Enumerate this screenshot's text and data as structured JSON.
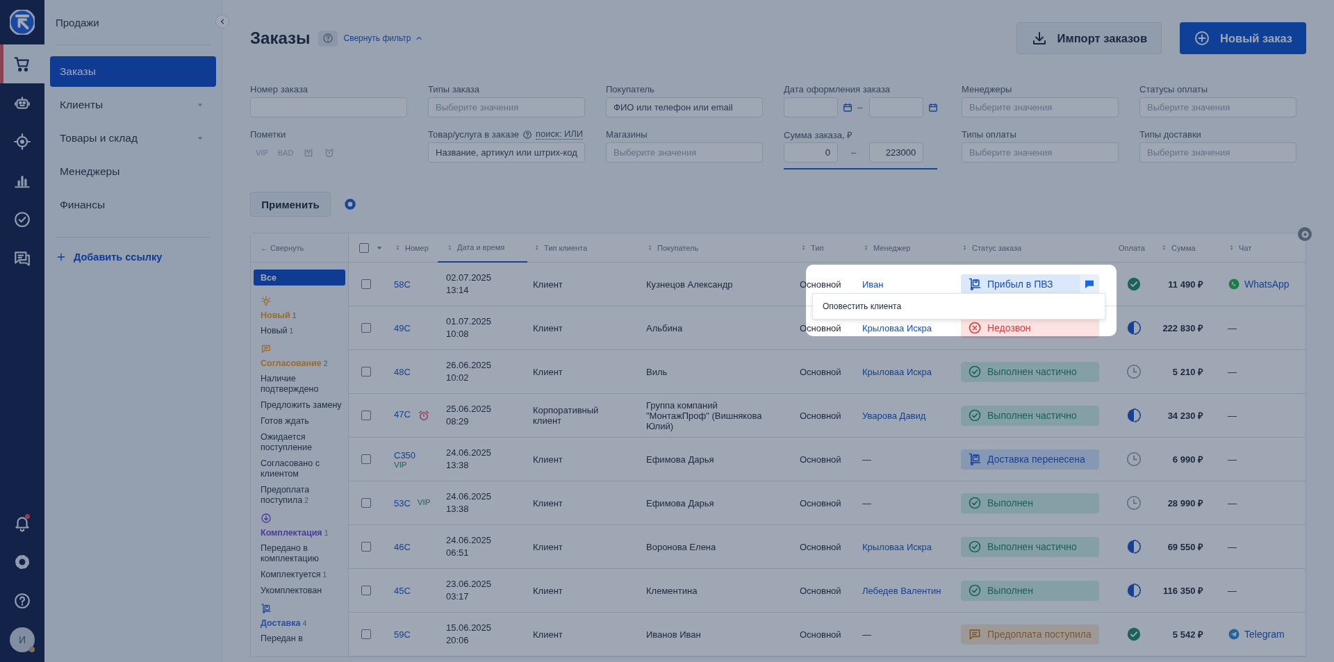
{
  "rail": {
    "items": [
      {
        "kind": "cart",
        "selected": true
      },
      {
        "kind": "robot",
        "selected": false
      },
      {
        "kind": "target",
        "selected": false
      },
      {
        "kind": "bars",
        "selected": false
      },
      {
        "kind": "checkc",
        "selected": false
      },
      {
        "kind": "chat",
        "selected": false
      }
    ],
    "bottom": [
      {
        "kind": "bell",
        "badge": true
      },
      {
        "kind": "gear",
        "badge": false
      },
      {
        "kind": "help",
        "badge": false
      }
    ],
    "avatar": "И"
  },
  "sidebar": {
    "title": "Продажи",
    "items": [
      {
        "label": "Заказы",
        "selected": true,
        "submenu": false
      },
      {
        "label": "Клиенты",
        "selected": false,
        "submenu": true
      },
      {
        "label": "Товары и склад",
        "selected": false,
        "submenu": true
      },
      {
        "label": "Менеджеры",
        "selected": false,
        "submenu": false
      },
      {
        "label": "Финансы",
        "selected": false,
        "submenu": false
      }
    ],
    "add_link": "Добавить ссылку"
  },
  "header": {
    "title": "Заказы",
    "toggle": "Свернуть фильтр",
    "import": "Импорт заказов",
    "new": "Новый заказ"
  },
  "filters": [
    {
      "kind": "text",
      "label": "Номер заказа"
    },
    {
      "kind": "select",
      "label": "Типы заказа",
      "placeholder": "Выберите значения"
    },
    {
      "kind": "text",
      "label": "Покупатель",
      "placeholder": "ФИО или телефон или email"
    },
    {
      "kind": "date_range",
      "label": "Дата оформления заказа",
      "dash": "–"
    },
    {
      "kind": "select",
      "label": "Менеджеры",
      "placeholder": "Выберите значения"
    },
    {
      "kind": "select",
      "label": "Статусы оплаты",
      "placeholder": "Выберите значения"
    },
    {
      "kind": "marks",
      "label": "Пометки",
      "marks": [
        {
          "kind": "text",
          "label": "VIP"
        },
        {
          "kind": "text",
          "label": "BAD"
        },
        {
          "kind": "box"
        },
        {
          "kind": "alarm"
        }
      ]
    },
    {
      "kind": "product",
      "label": "Товар/услуга в заказе",
      "link": "поиск: ИЛИ",
      "placeholder": "Название, артикул или штрих-код"
    },
    {
      "kind": "select",
      "label": "Магазины",
      "placeholder": "Выберите значения"
    },
    {
      "kind": "range",
      "label": "Сумма заказа, ₽",
      "from": "0",
      "dash": "–",
      "to": "223000"
    },
    {
      "kind": "select",
      "label": "Типы оплаты",
      "placeholder": "Выберите значения"
    },
    {
      "kind": "select",
      "label": "Типы доставки",
      "placeholder": "Выберите значения"
    }
  ],
  "apply": "Применить",
  "status_panel": {
    "collapse": "← Свернуть",
    "all": {
      "label": "Все",
      "selected": true
    },
    "groups": [
      {
        "kind": "new",
        "label": "Новый",
        "count": "1",
        "color": "#9c6a2c",
        "items": [
          {
            "label": "Новый",
            "count": "1"
          }
        ]
      },
      {
        "kind": "agree",
        "label": "Согласование",
        "count": "2",
        "color": "#9c6a2c",
        "items": [
          {
            "label": "Наличие подтверждено"
          },
          {
            "label": "Предложить замену"
          },
          {
            "label": "Готов ждать"
          },
          {
            "label": "Ожидается поступление"
          },
          {
            "label": "Согласовано с клиентом"
          },
          {
            "label": "Предоплата поступила",
            "count": "2"
          }
        ]
      },
      {
        "kind": "pack",
        "label": "Комплектация",
        "count": "1",
        "color": "#4a3c98",
        "items": [
          {
            "label": "Передано в комплектацию"
          },
          {
            "label": "Комплектуется",
            "count": "1"
          },
          {
            "label": "Укомплектован"
          }
        ]
      },
      {
        "kind": "delivery",
        "label": "Доставка",
        "count": "4",
        "color": "#2a4ea0",
        "items": [
          {
            "label": "Передан в"
          }
        ]
      }
    ]
  },
  "table": {
    "all_checked": false,
    "columns": [
      {
        "label": "Номер",
        "sortable": true,
        "sorted": false
      },
      {
        "label": "Дата и время",
        "sortable": true,
        "sorted": true
      },
      {
        "label": "Тип клиента",
        "sortable": true,
        "sorted": false
      },
      {
        "label": "Покупатель",
        "sortable": true,
        "sorted": false
      },
      {
        "label": "Тип",
        "sortable": true,
        "sorted": false
      },
      {
        "label": "Менеджер",
        "sortable": true,
        "sorted": false
      },
      {
        "label": "Статус заказа",
        "sortable": true,
        "sorted": false
      },
      {
        "label": "Оплата",
        "sortable": false,
        "sorted": false
      },
      {
        "label": "Сумма",
        "sortable": true,
        "sorted": false
      },
      {
        "label": "Чат",
        "sortable": true,
        "sorted": false
      }
    ],
    "rows": [
      {
        "checked": false,
        "number": "58С",
        "alarm": false,
        "date": "02.07.2025 13:14",
        "client_type": "Клиент",
        "buyer": "Кузнецов Александр",
        "type": "Основной",
        "manager": {
          "name": "Иван",
          "link": true
        },
        "status": {
          "kind": "pvz",
          "label": "Прибыл в ПВЗ"
        },
        "notify": true,
        "payment": {
          "kind": "paid"
        },
        "sum": "11 490 ₽",
        "chat": {
          "kind": "whatsapp",
          "label": "WhatsApp"
        }
      },
      {
        "checked": false,
        "number": "49С",
        "alarm": false,
        "date": "01.07.2025 10:08",
        "client_type": "Клиент",
        "buyer": "Альбина",
        "type": "Основной",
        "manager": {
          "name": "Крыловаа Искра",
          "link": true
        },
        "status": {
          "kind": "missed",
          "label": "Недозвон"
        },
        "notify": false,
        "payment": {
          "kind": "partial"
        },
        "sum": "222 830 ₽",
        "chat": {
          "kind": "none",
          "label": "—"
        }
      },
      {
        "checked": false,
        "number": "48С",
        "alarm": false,
        "date": "26.06.2025 10:02",
        "client_type": "Клиент",
        "buyer": "Виль",
        "type": "Основной",
        "manager": {
          "name": "Крыловаа Искра",
          "link": true
        },
        "status": {
          "kind": "done",
          "label": "Выполнен частично"
        },
        "notify": false,
        "payment": {
          "kind": "pending"
        },
        "sum": "5 210 ₽",
        "chat": {
          "kind": "none",
          "label": "—"
        }
      },
      {
        "checked": false,
        "number": "47С",
        "alarm": true,
        "date": "25.06.2025 08:29",
        "client_type": "Корпоративный клиент",
        "buyer": "Группа компаний \"МонтажПроф\" (Вишнякова Юлий)",
        "type": "Основной",
        "manager": {
          "name": "Уварова Давид",
          "link": true
        },
        "status": {
          "kind": "done",
          "label": "Выполнен частично"
        },
        "notify": false,
        "payment": {
          "kind": "partial"
        },
        "sum": "34 230 ₽",
        "chat": {
          "kind": "none",
          "label": "—"
        }
      },
      {
        "checked": false,
        "number": "С350",
        "vip": "VIP",
        "alarm": false,
        "date": "24.06.2025 13:38",
        "client_type": "Клиент",
        "buyer": "Ефимова Дарья",
        "type": "Основной",
        "manager": {
          "name": "—",
          "link": false
        },
        "status": {
          "kind": "delivery",
          "label": "Доставка перенесена"
        },
        "notify": false,
        "payment": {
          "kind": "pending"
        },
        "sum": "6 990 ₽",
        "chat": {
          "kind": "none",
          "label": "—"
        }
      },
      {
        "checked": false,
        "number": "53С",
        "vip": "VIP",
        "alarm": false,
        "date": "24.06.2025 13:38",
        "client_type": "Клиент",
        "buyer": "Ефимова Дарья",
        "type": "Основной",
        "manager": {
          "name": "—",
          "link": false
        },
        "status": {
          "kind": "done",
          "label": "Выполнен"
        },
        "notify": false,
        "payment": {
          "kind": "pending"
        },
        "sum": "28 990 ₽",
        "chat": {
          "kind": "none",
          "label": "—"
        }
      },
      {
        "checked": false,
        "number": "46С",
        "alarm": false,
        "date": "24.06.2025 06:51",
        "client_type": "Клиент",
        "buyer": "Воронова Елена",
        "type": "Основной",
        "manager": {
          "name": "Крыловаа Искра",
          "link": true
        },
        "status": {
          "kind": "done",
          "label": "Выполнен частично"
        },
        "notify": false,
        "payment": {
          "kind": "partial"
        },
        "sum": "69 550 ₽",
        "chat": {
          "kind": "none",
          "label": "—"
        }
      },
      {
        "checked": false,
        "number": "45С",
        "alarm": false,
        "date": "23.06.2025 03:17",
        "client_type": "Клиент",
        "buyer": "Клементина",
        "type": "Основной",
        "manager": {
          "name": "Лебедев Валентин",
          "link": true
        },
        "status": {
          "kind": "done",
          "label": "Выполнен"
        },
        "notify": false,
        "payment": {
          "kind": "partial"
        },
        "sum": "116 350 ₽",
        "chat": {
          "kind": "none",
          "label": "—"
        }
      },
      {
        "checked": false,
        "number": "59С",
        "alarm": false,
        "date": "15.06.2025 20:06",
        "client_type": "Клиент",
        "buyer": "Иванов Иван",
        "type": "Основной",
        "manager": {
          "name": "—",
          "link": false
        },
        "status": {
          "kind": "prepaid",
          "label": "Предоплата поступила"
        },
        "notify": false,
        "payment": {
          "kind": "paid"
        },
        "sum": "5 542 ₽",
        "chat": {
          "kind": "telegram",
          "label": "Telegram"
        }
      }
    ]
  },
  "popup": {
    "text": "Оповестить клиента"
  }
}
